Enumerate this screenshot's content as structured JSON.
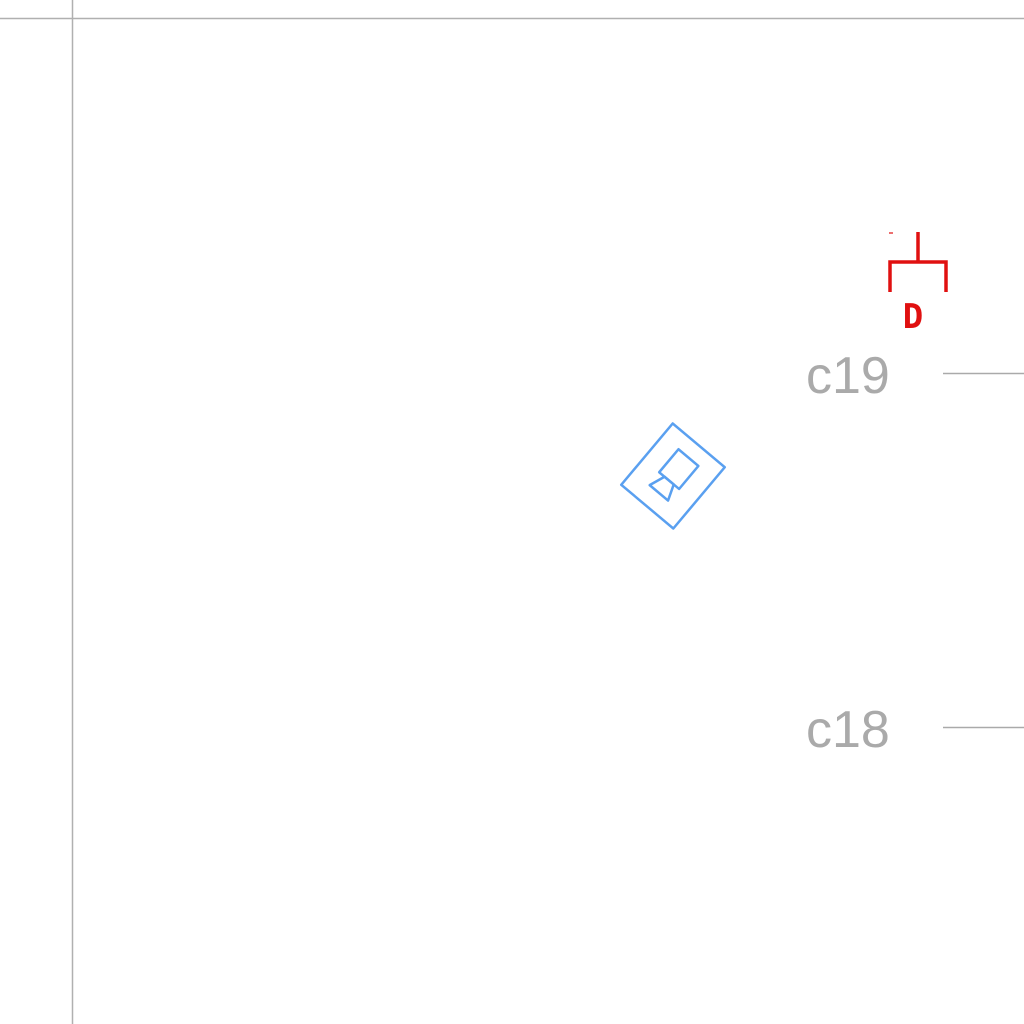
{
  "drawing": {
    "row_labels": [
      {
        "id": "c19",
        "text": "c19"
      },
      {
        "id": "c18",
        "text": "c18"
      }
    ],
    "red_symbol": {
      "letter": "D",
      "icon": "distribution-bracket-icon",
      "color": "#e01010"
    },
    "blue_symbol": {
      "icon": "camera-device-icon",
      "color": "#5aa0f0"
    },
    "line_color": "#aaaaaa"
  }
}
